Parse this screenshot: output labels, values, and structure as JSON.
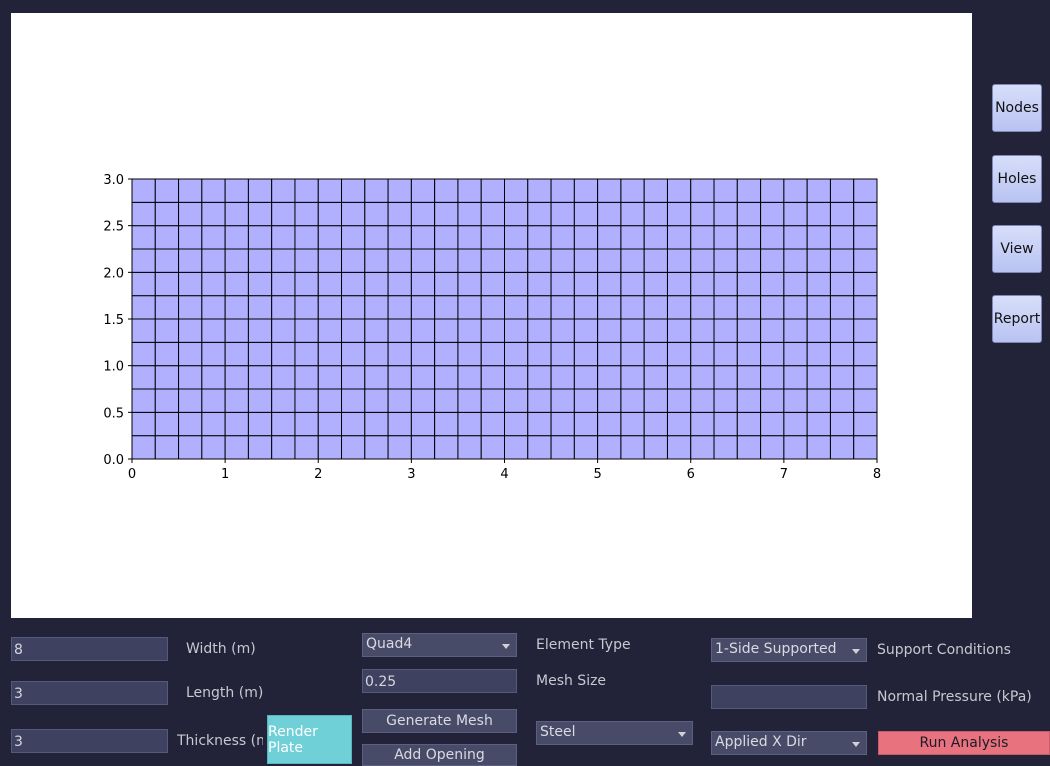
{
  "side_buttons": {
    "nodes": "Nodes",
    "holes": "Holes",
    "view": "View",
    "report": "Report"
  },
  "chart_data": {
    "type": "mesh",
    "title": "",
    "xlabel": "",
    "ylabel": "",
    "xlim": [
      0,
      8
    ],
    "ylim": [
      0,
      3
    ],
    "xticks": [
      "0",
      "1",
      "2",
      "3",
      "4",
      "5",
      "6",
      "7",
      "8"
    ],
    "yticks": [
      "0.0",
      "0.5",
      "1.0",
      "1.5",
      "2.0",
      "2.5",
      "3.0"
    ],
    "plate_width": 8,
    "plate_length": 3,
    "mesh_size": 0.25,
    "element_color": "#b0b0ff",
    "edge_color": "#000000",
    "grid": false
  },
  "controls": {
    "width_value": "8",
    "width_label": "Width (m)",
    "length_value": "3",
    "length_label": "Length (m)",
    "thickness_value": "3",
    "thickness_label": "Thickness (n",
    "render_plate": "Render Plate",
    "element_type_value": "Quad4",
    "element_type_label": "Element Type",
    "mesh_size_value": "0.25",
    "mesh_size_label": "Mesh Size",
    "generate_mesh": "Generate Mesh",
    "add_opening": "Add Opening",
    "material_value": "Steel",
    "support_value": "1-Side Supported",
    "support_label": "Support Conditions",
    "pressure_value": "",
    "pressure_label": "Normal Pressure (kPa)",
    "direction_value": "Applied X Dir",
    "run_analysis": "Run Analysis"
  }
}
